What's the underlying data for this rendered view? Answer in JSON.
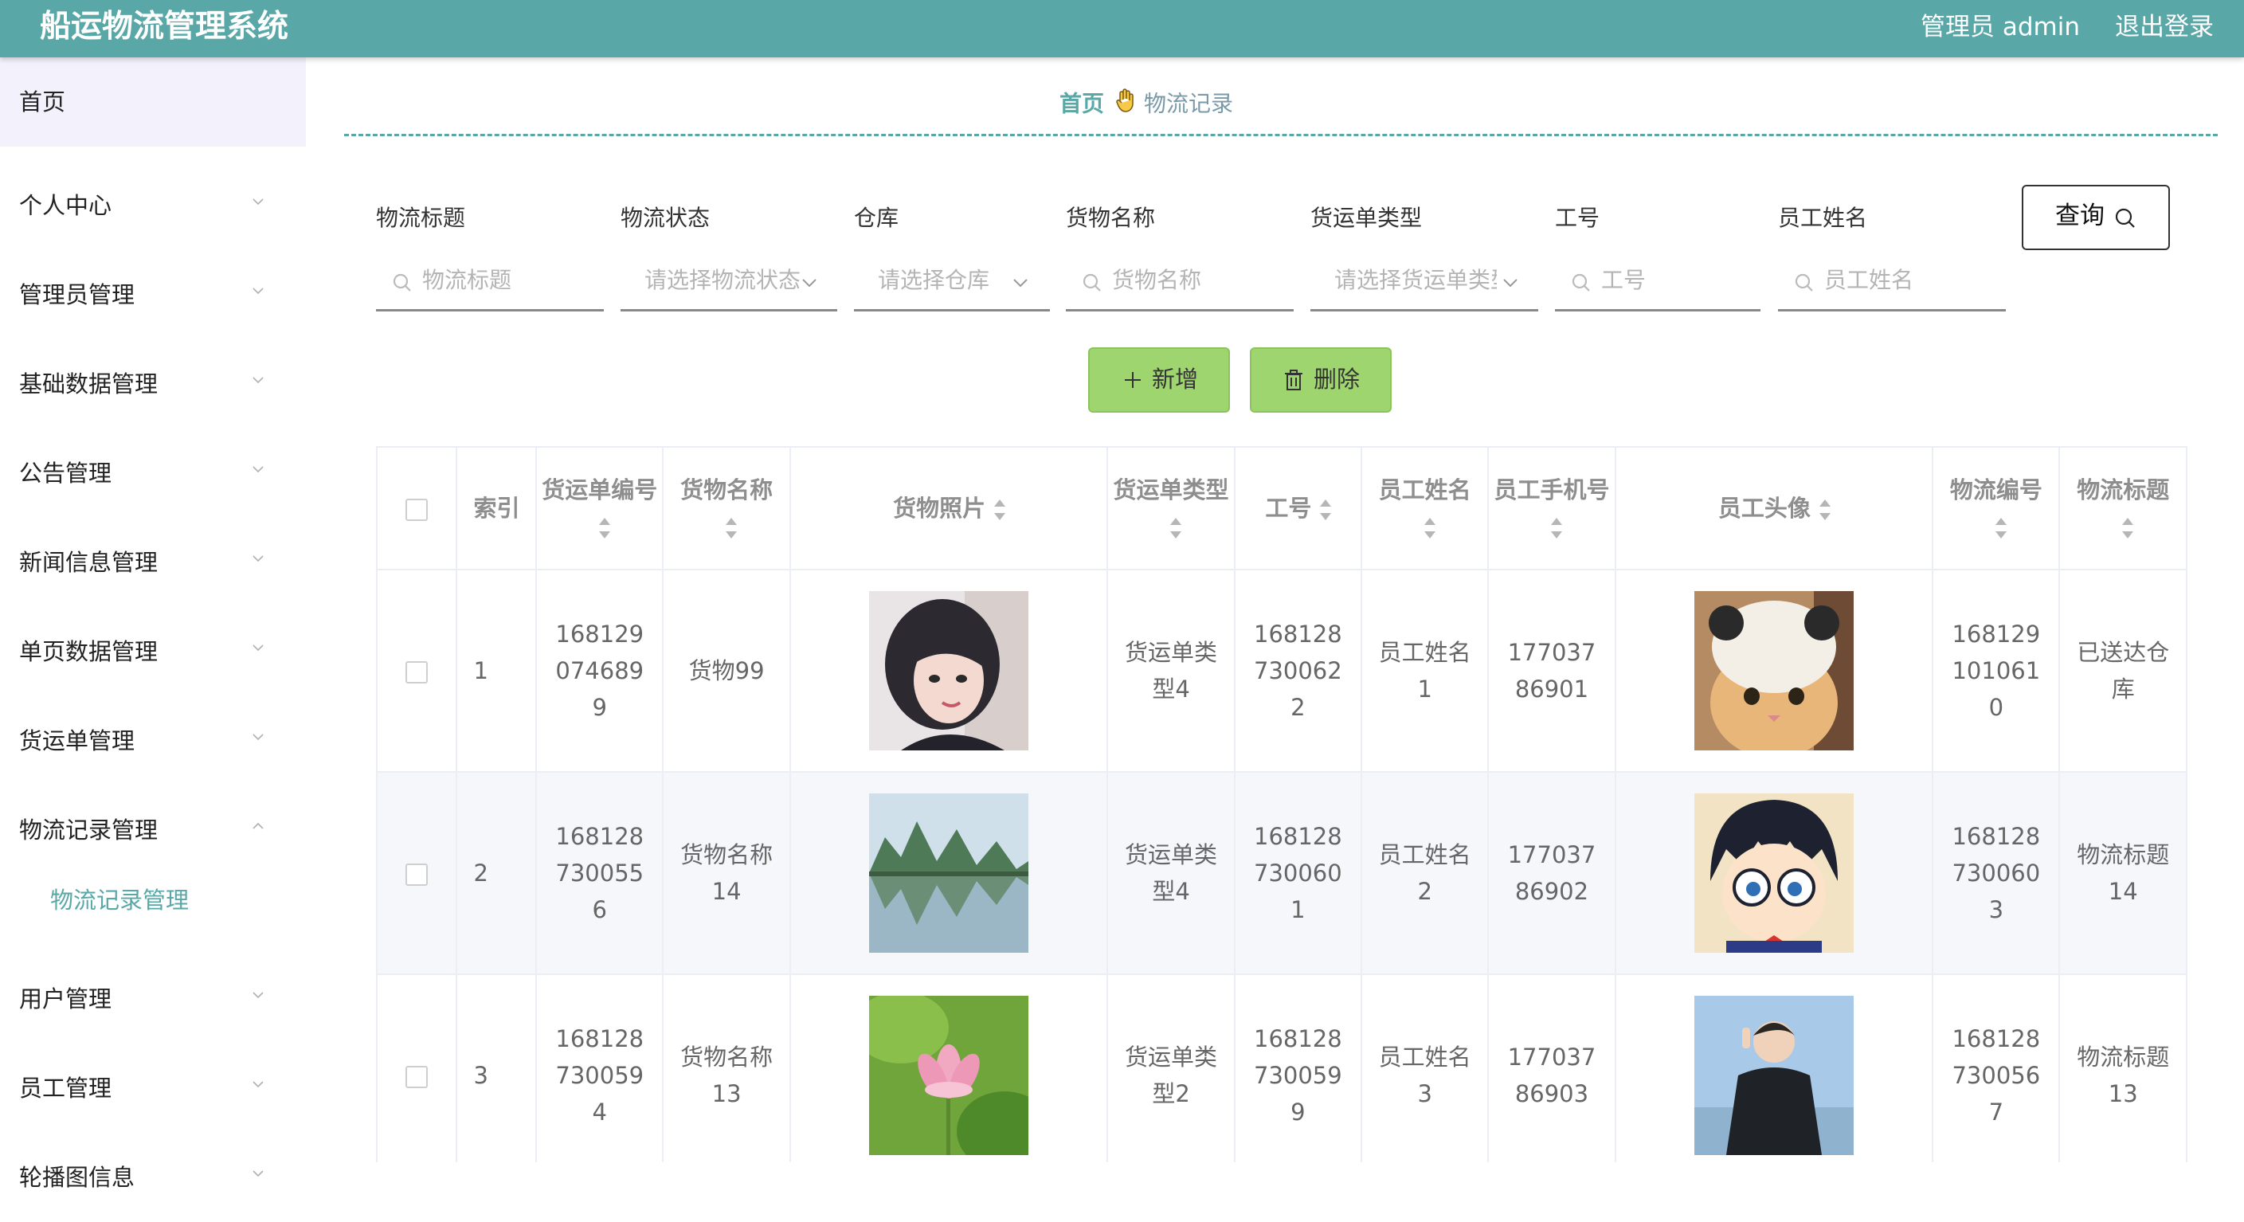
{
  "header": {
    "title": "船运物流管理系统",
    "admin_label": "管理员 admin",
    "logout_label": "退出登录"
  },
  "sidebar": {
    "items": [
      {
        "label": "首页"
      },
      {
        "label": "个人中心"
      },
      {
        "label": "管理员管理"
      },
      {
        "label": "基础数据管理"
      },
      {
        "label": "公告管理"
      },
      {
        "label": "新闻信息管理"
      },
      {
        "label": "单页数据管理"
      },
      {
        "label": "货运单管理"
      },
      {
        "label": "物流记录管理"
      },
      {
        "label": "物流记录管理"
      },
      {
        "label": "用户管理"
      },
      {
        "label": "员工管理"
      },
      {
        "label": "轮播图信息"
      }
    ]
  },
  "breadcrumb": {
    "home": "首页",
    "current": "物流记录"
  },
  "filters": [
    {
      "label": "物流标题",
      "placeholder": "物流标题"
    },
    {
      "label": "物流状态",
      "placeholder": "请选择物流状态"
    },
    {
      "label": "仓库",
      "placeholder": "请选择仓库"
    },
    {
      "label": "货物名称",
      "placeholder": "货物名称"
    },
    {
      "label": "货运单类型",
      "placeholder": "请选择货运单类型"
    },
    {
      "label": "工号",
      "placeholder": "工号"
    },
    {
      "label": "员工姓名",
      "placeholder": "员工姓名"
    }
  ],
  "buttons": {
    "query": "查询",
    "add": "新增",
    "delete": "删除"
  },
  "table": {
    "headers": [
      "索引",
      "货运单编号",
      "货物名称",
      "货物照片",
      "货运单类型",
      "工号",
      "员工姓名",
      "员工手机号",
      "员工头像",
      "物流编号",
      "物流标题"
    ],
    "rows": [
      {
        "index": "1",
        "order_no": "1681290746899",
        "goods_name": "货物99",
        "goods_photo": "portrait of a young woman with dark bob hair",
        "order_type": "货运单类型4",
        "emp_no": "1681287300622",
        "emp_name": "员工姓名1",
        "emp_phone": "17703786901",
        "emp_avatar": "cat wearing a white knit hat",
        "logistics_no": "1681291010610",
        "logistics_title": "已送达仓库"
      },
      {
        "index": "2",
        "order_no": "1681287300556",
        "goods_name": "货物名称14",
        "goods_photo": "karst mountains reflected in a lake",
        "order_type": "货运单类型4",
        "emp_no": "1681287300601",
        "emp_name": "员工姓名2",
        "emp_phone": "17703786902",
        "emp_avatar": "cartoon boy with glasses and red bow tie",
        "logistics_no": "1681287300603",
        "logistics_title": "物流标题14"
      },
      {
        "index": "3",
        "order_no": "1681287300594",
        "goods_name": "货物名称13",
        "goods_photo": "pink lotus flower on green leaves",
        "order_type": "货运单类型2",
        "emp_no": "1681287300599",
        "emp_name": "员工姓名3",
        "emp_phone": "17703786903",
        "emp_avatar": "young man in black jacket at the beach",
        "logistics_no": "1681287300567",
        "logistics_title": "物流标题13"
      }
    ]
  },
  "colors": {
    "primary": "#5aa7a7",
    "button_green": "#9fd56f",
    "sidebar_active_bg": "#f3f1fb",
    "stripe": "#f5f7fa"
  }
}
